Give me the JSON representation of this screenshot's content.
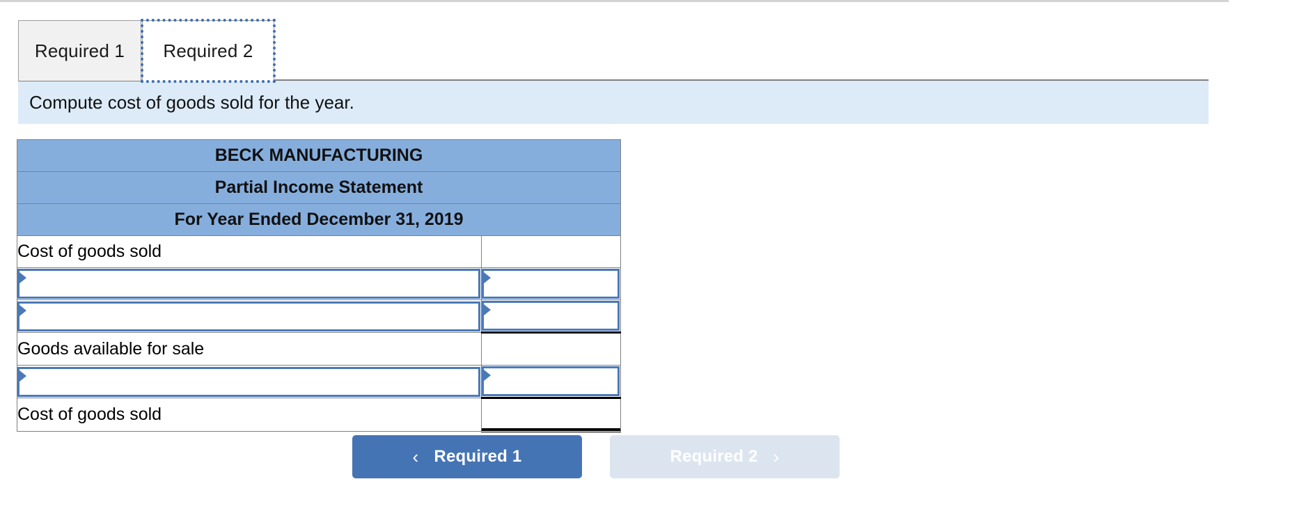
{
  "tabs": [
    {
      "label": "Required 1",
      "state": "inactive"
    },
    {
      "label": "Required 2",
      "state": "active"
    }
  ],
  "banner": {
    "instruction": "Compute cost of goods sold for the year."
  },
  "worksheet": {
    "headers": [
      "BECK MANUFACTURING",
      "Partial Income Statement",
      "For Year Ended December 31, 2019"
    ],
    "rows": [
      {
        "type": "label",
        "label": "Cost of goods sold",
        "indent": false,
        "value": ""
      },
      {
        "type": "dropdown",
        "label": "",
        "value": ""
      },
      {
        "type": "dropdown",
        "label": "",
        "value": ""
      },
      {
        "type": "label",
        "label": "Goods available for sale",
        "indent": true,
        "value": ""
      },
      {
        "type": "dropdown",
        "label": "",
        "value": ""
      },
      {
        "type": "label",
        "label": "Cost of goods sold",
        "indent": true,
        "value": ""
      }
    ]
  },
  "navigation": {
    "prev": {
      "label": "Required 1",
      "icon": "chevron-left-icon",
      "glyph": "‹",
      "enabled": true
    },
    "next": {
      "label": "Required 2",
      "icon": "chevron-right-icon",
      "glyph": "›",
      "enabled": false
    }
  },
  "colors": {
    "header_blue": "#86aedd",
    "banner_blue": "#dcebf7",
    "primary_button": "#4574b5",
    "disabled_button": "#dce5ef",
    "input_border": "#4a79b8",
    "grid_line": "#808080"
  }
}
